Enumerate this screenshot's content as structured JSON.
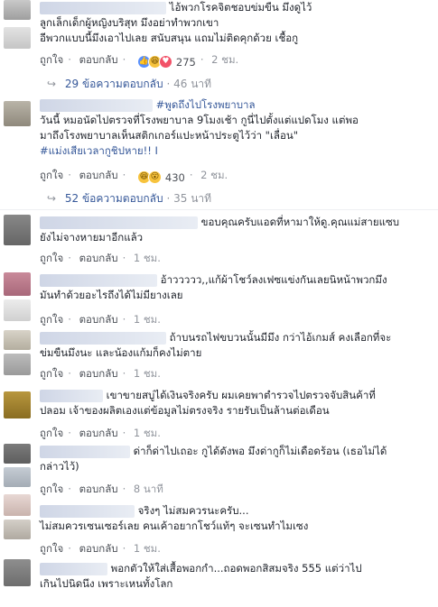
{
  "comments": [
    {
      "lines": [
        "ไอ้พวกโรคจิตชอบข่มขืน มึงดูไว้",
        "ลูกเล็กเด็กผู้หญิงบริสุท มึงอย่าทำพวกเขา",
        "อีพวกแบบนี้มึงเอาไปเลย สนับสนุน แถมไม่ติดคุกด้วย เชื้อกู"
      ],
      "like": "ถูกใจ",
      "reply": "ตอบกลับ",
      "reaction_count": "275",
      "time": "2 ชม.",
      "replies_label": "29 ข้อความตอบกลับ",
      "replies_time": "46 นาที"
    },
    {
      "tag": "#พูดถึงไปโรงพยาบาล",
      "lines": [
        "วันนี้ หมอนัดไปตรวจที่โรงพยาบาล 9โมงเช้า กูนี่ไปตั้งแต่แปดโมง แต่พอ",
        "มาถึงโรงพยาบาลเห็นสติกเกอร์แปะหน้าประตูไว้ว่า \"เลื่อน\"",
        "#แม่งเสียเวลากูชิปหาย!! I"
      ],
      "like": "ถูกใจ",
      "reply": "ตอบกลับ",
      "reaction_count": "430",
      "time": "2 ชม.",
      "replies_label": "52 ข้อความตอบกลับ",
      "replies_time": "35 นาที"
    },
    {
      "lines": [
        "ขอบคุณครับแอดที่หามาให้ดู.คุณแม่สายแซบ",
        "ยังไม่จางหายมาอีกแล้ว"
      ],
      "like": "ถูกใจ",
      "reply": "ตอบกลับ",
      "time": "1 ชม."
    },
    {
      "lines": [
        "อ้าววววว,,แก้ผ้าโชว์ลงเฟซแข่งกันเลยนิหน้าพวกมึง",
        "มันทำด้วยอะไรถึงได้ไม่มียางเลย"
      ],
      "like": "ถูกใจ",
      "reply": "ตอบกลับ",
      "time": "1 ชม."
    },
    {
      "lines": [
        "ถ้าบนรถไฟขบวนนั้นมีมึง กว่าไอ้เกมส์ คงเลือกที่จะ",
        "ข่มขืนมึงนะ และน้องแก้มก็คงไม่ตาย"
      ],
      "like": "ถูกใจ",
      "reply": "ตอบกลับ",
      "time": "1 ชม."
    },
    {
      "lines": [
        "เขาขายสบู่ได้เงินจริงครับ ผมเคยพาตำรวจไปตรวจจับสินค้าที่",
        "ปลอม เจ้าของผลิตเองแต่ข้อมูลไม่ตรงจริง รายรับเป็นล้านต่อเดือน"
      ],
      "like": "ถูกใจ",
      "reply": "ตอบกลับ",
      "time": "1 ชม."
    },
    {
      "lines": [
        "ด่าก็ด่าไปเถอะ กูได้ดังพอ มึงด่ากูก็ไม่เดือดร้อน (เธอไม่ได้",
        "กล่าวไว้)"
      ],
      "like": "ถูกใจ",
      "reply": "ตอบกลับ",
      "time": "8 นาที"
    },
    {
      "lines": [
        "จริงๆ ไม่สมควรนะครับ...",
        "ไม่สมควรเซนเซอร์เลย คนเค้าอยากโชว์แท้ๆ จะเซนทำไมเซง"
      ],
      "like": "ถูกใจ",
      "reply": "ตอบกลับ",
      "time": "1 ชม."
    },
    {
      "lines": [
        "พอกตัวให้ใส่เสื้อพอกกำ...ถอดพอกสิสมจริง 555 แต่ว่าไป",
        "เกินไปนิดนึง เพราะเหนทั้งโลก"
      ],
      "like": "ถูกใจ",
      "reply": "ตอบกลับ"
    }
  ],
  "colors": {
    "link": "#365899",
    "meta": "#90949c",
    "text": "#1d2129"
  }
}
